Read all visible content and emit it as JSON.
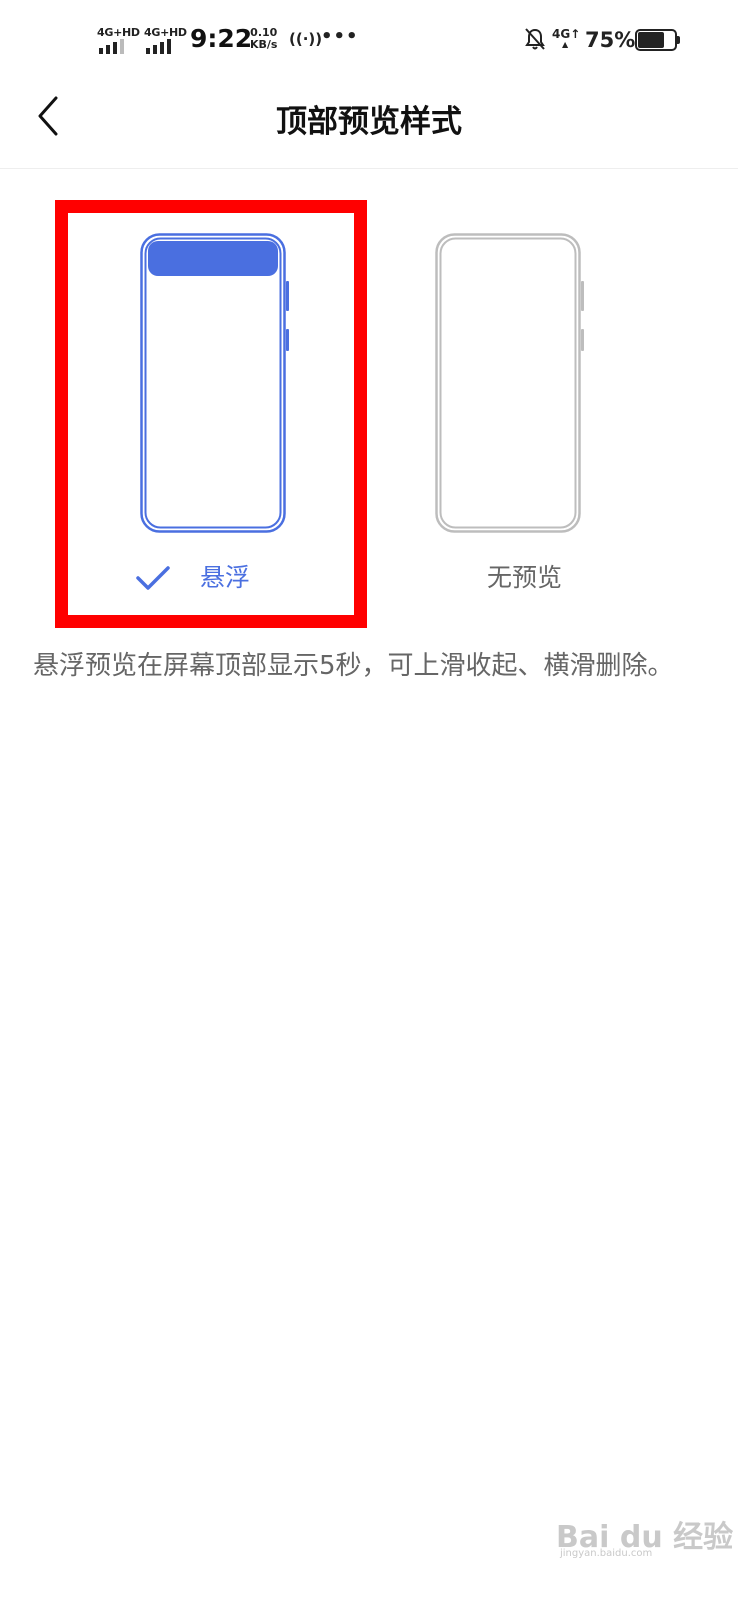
{
  "status_bar": {
    "signal1_label": "4G+HD",
    "signal2_label": "4G+HD",
    "time": "9:22",
    "speed_value": "0.10",
    "speed_unit": "KB/s",
    "network_type": "4G",
    "battery": "75%",
    "battery_level": 0.75
  },
  "header": {
    "title": "顶部预览样式"
  },
  "options": [
    {
      "label": "悬浮",
      "selected": true
    },
    {
      "label": "无预览",
      "selected": false
    }
  ],
  "description": "悬浮预览在屏幕顶部显示5秒，可上滑收起、横滑删除。",
  "watermark": {
    "brand": "Bai du 经验",
    "url": "jingyan.baidu.com"
  },
  "colors": {
    "accent": "#4a6fe0",
    "highlight": "#ff0000",
    "inactive": "#bdbdbd",
    "description": "#666666"
  }
}
